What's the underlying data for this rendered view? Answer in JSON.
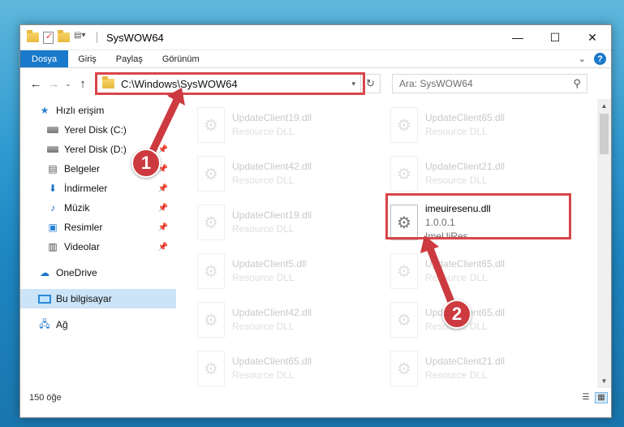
{
  "window": {
    "title": "SysWOW64",
    "controls": {
      "minimize": "—",
      "maximize": "☐",
      "close": "✕"
    }
  },
  "ribbon": {
    "tabs": [
      "Dosya",
      "Giriş",
      "Paylaş",
      "Görünüm"
    ],
    "help": "?",
    "collapse": "⌄"
  },
  "nav": {
    "back": "←",
    "forward": "→",
    "recent": "⌄",
    "up": "↑",
    "address": "C:\\Windows\\SysWOW64",
    "refresh": "↻",
    "search_placeholder": "Ara: SysWOW64",
    "search_icon": "⚲"
  },
  "sidebar": {
    "items": [
      {
        "label": "Hızlı erişim",
        "icon": "star-icon",
        "pinned": false
      },
      {
        "label": "Yerel Disk (C:)",
        "icon": "drive-icon",
        "pinned": true
      },
      {
        "label": "Yerel Disk (D:)",
        "icon": "drive-icon",
        "pinned": true
      },
      {
        "label": "Belgeler",
        "icon": "documents-icon",
        "pinned": true
      },
      {
        "label": "İndirmeler",
        "icon": "download-icon",
        "pinned": true
      },
      {
        "label": "Müzik",
        "icon": "music-icon",
        "pinned": true
      },
      {
        "label": "Resimler",
        "icon": "pictures-icon",
        "pinned": true
      },
      {
        "label": "Videolar",
        "icon": "video-icon",
        "pinned": true
      },
      {
        "label": "OneDrive",
        "icon": "cloud-icon",
        "pinned": false
      },
      {
        "label": "Bu bilgisayar",
        "icon": "computer-icon",
        "pinned": false
      },
      {
        "label": "Ağ",
        "icon": "network-icon",
        "pinned": false
      }
    ]
  },
  "files": [
    {
      "name": "UpdateClient19.dll",
      "sub": "Resource DLL"
    },
    {
      "name": "UpdateClient65.dll",
      "sub": "Resource DLL"
    },
    {
      "name": "UpdateClient42.dll",
      "sub": "Resource DLL"
    },
    {
      "name": "UpdateClient21.dll",
      "sub": "Resource DLL"
    },
    {
      "name": "UpdateClient19.dll",
      "sub": "Resource DLL"
    },
    {
      "name": "imeuiresenu.dll",
      "version": "1.0.0.1",
      "sub": "ImeUiRes"
    },
    {
      "name": "UpdateClient5.dll",
      "sub": "Resource DLL"
    },
    {
      "name": "UpdateClient65.dll",
      "sub": "Resource DLL"
    },
    {
      "name": "UpdateClient42.dll",
      "sub": "Resource DLL"
    },
    {
      "name": "UpdateClient65.dll",
      "sub": "Resource DLL"
    },
    {
      "name": "UpdateClient65.dll",
      "sub": "Resource DLL"
    },
    {
      "name": "UpdateClient21.dll",
      "sub": "Resource DLL"
    }
  ],
  "status": {
    "count": "150 öğe",
    "view_details": "☰",
    "view_tiles": "▦"
  },
  "annotations": {
    "one": "1",
    "two": "2"
  },
  "colors": {
    "accent": "#1979ca",
    "highlight": "#d9454a",
    "badge": "#cc3a3f"
  }
}
